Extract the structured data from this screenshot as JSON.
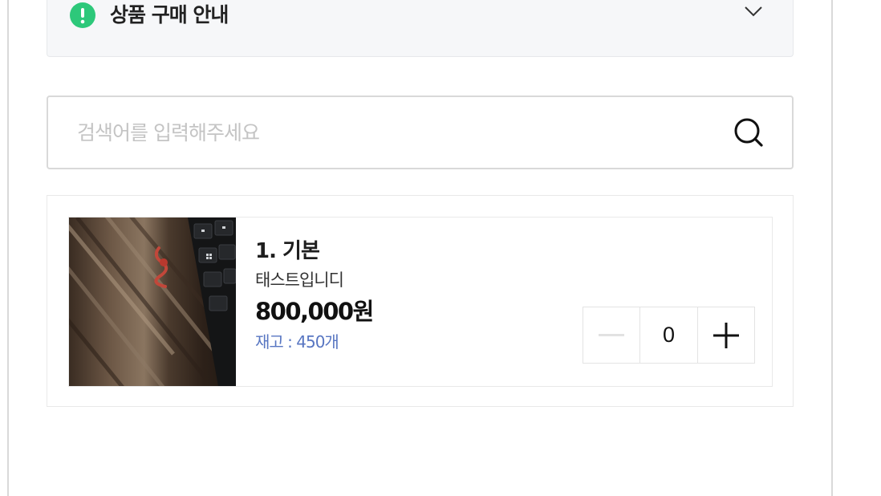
{
  "notice": {
    "title": "상품 구매 안내",
    "icon": "exclamation-circle-icon",
    "expand_icon": "chevron-down-icon",
    "accent": "#2dc87a"
  },
  "search": {
    "placeholder": "검색어를 입력해주세요",
    "value": "",
    "icon": "search-icon"
  },
  "products": [
    {
      "name": "1. 기본",
      "description": "태스트입니디",
      "price": "800,000원",
      "stock": "재고 : 450개",
      "quantity": "0",
      "decrement_icon": "minus-icon",
      "increment_icon": "plus-icon",
      "image": "product-photo",
      "stock_color": "#5876c2"
    }
  ]
}
